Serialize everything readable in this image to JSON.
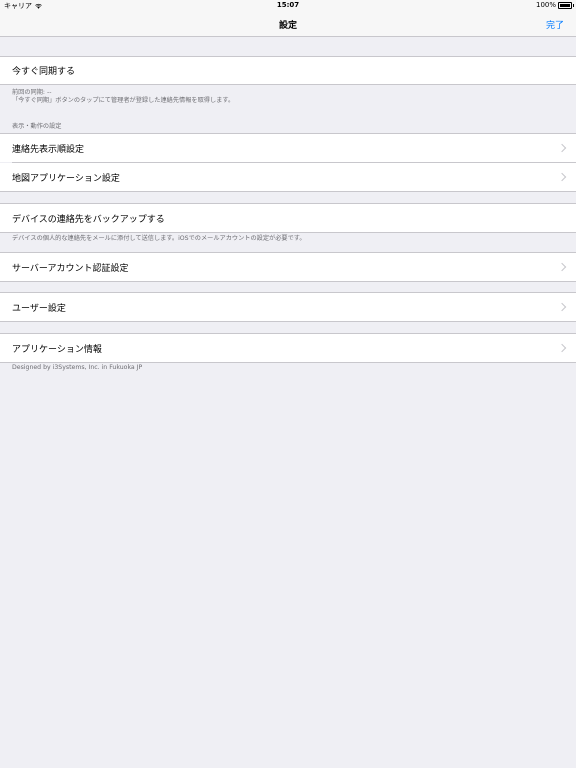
{
  "status_bar": {
    "carrier": "キャリア",
    "time": "15:07",
    "battery": "100%"
  },
  "nav": {
    "title": "設定",
    "done": "完了"
  },
  "sync": {
    "label": "今すぐ同期する",
    "footer_line1": "前回の同期: --",
    "footer_line2": "「今すぐ同期」ボタンのタップにて管理者が登録した連絡先情報を取得します。"
  },
  "display_section": {
    "header": "表示・動作の設定",
    "items": [
      {
        "label": "連絡先表示順設定"
      },
      {
        "label": "地図アプリケーション設定"
      }
    ]
  },
  "backup": {
    "label": "デバイスの連絡先をバックアップする",
    "footer": "デバイスの個人的な連絡先をメールに添付して送信します。iOSでのメールアカウントの設定が必要です。"
  },
  "server": {
    "label": "サーバーアカウント認証設定"
  },
  "user": {
    "label": "ユーザー設定"
  },
  "app_info": {
    "label": "アプリケーション情報",
    "footer": "Designed by i3Systems, Inc. in Fukuoka JP"
  }
}
